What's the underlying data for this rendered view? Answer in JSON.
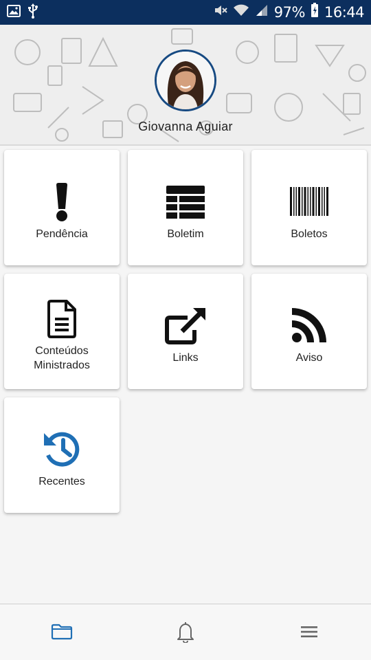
{
  "status_bar": {
    "battery_percent": "97%",
    "time": "16:44",
    "icons": [
      "image-icon",
      "usb-icon",
      "mute-icon",
      "wifi-icon",
      "signal-icon",
      "battery-icon"
    ]
  },
  "profile": {
    "name": "Giovanna Aguiar"
  },
  "tiles": [
    {
      "label": "Pendência",
      "icon": "exclamation-icon"
    },
    {
      "label": "Boletim",
      "icon": "table-icon"
    },
    {
      "label": "Boletos",
      "icon": "barcode-icon"
    },
    {
      "label_line1": "Conteúdos",
      "label_line2": "Ministrados",
      "icon": "document-icon"
    },
    {
      "label": "Links",
      "icon": "external-link-icon"
    },
    {
      "label": "Aviso",
      "icon": "rss-icon"
    },
    {
      "label": "Recentes",
      "icon": "history-icon"
    }
  ],
  "bottom_nav": {
    "items": [
      "folder-icon",
      "bell-icon",
      "menu-icon"
    ],
    "active": "folder-icon"
  },
  "colors": {
    "status_bar": "#0c2f5e",
    "accent": "#1f6fb5",
    "icon": "#111111"
  }
}
